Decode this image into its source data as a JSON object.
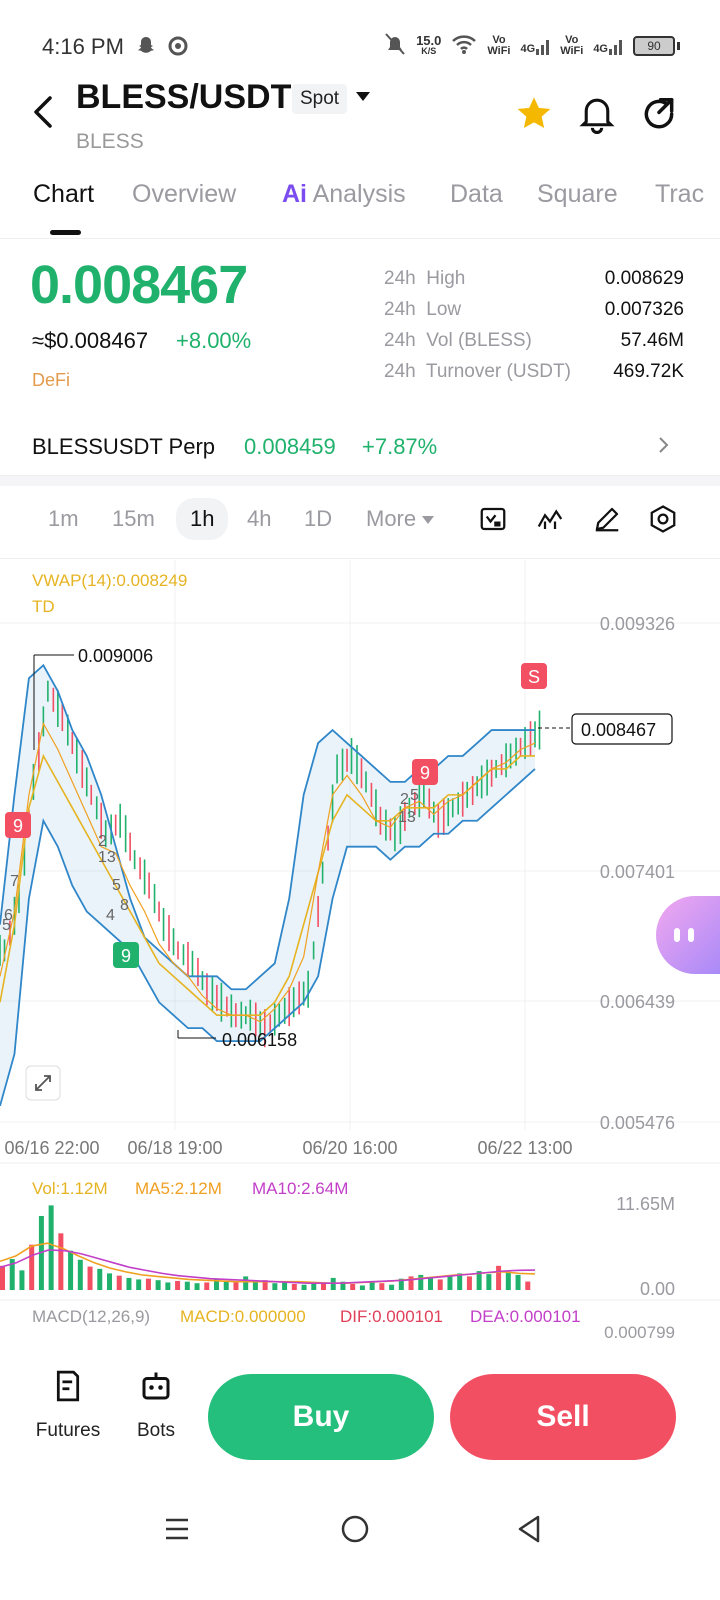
{
  "status_bar": {
    "time": "4:16 PM",
    "speed_value": "15.0",
    "speed_unit": "K/S",
    "vowifi_1": "Vo\nWiFi",
    "net_1": "4G",
    "vowifi_2": "Vo\nWiFi",
    "net_2": "4G",
    "battery": "90"
  },
  "header": {
    "pair": "BLESS/USDT",
    "market_type": "Spot",
    "base_asset": "BLESS"
  },
  "tabs": [
    {
      "label": "Chart",
      "active": true
    },
    {
      "label": "Overview",
      "active": false
    },
    {
      "label": "Analysis",
      "ai_prefix": "Ai",
      "active": false
    },
    {
      "label": "Data",
      "active": false
    },
    {
      "label": "Square",
      "active": false
    },
    {
      "label": "Trac",
      "active": false
    }
  ],
  "price": {
    "last": "0.008467",
    "usd_equivalent": "≈$0.008467",
    "change_pct": "+8.00%",
    "sector": "DeFi"
  },
  "stats": [
    {
      "label": "24h  High",
      "value": "0.008629"
    },
    {
      "label": "24h  Low",
      "value": "0.007326"
    },
    {
      "label": "24h  Vol (BLESS)",
      "value": "57.46M"
    },
    {
      "label": "24h  Turnover (USDT)",
      "value": "469.72K"
    }
  ],
  "perp": {
    "name": "BLESSUSDT Perp",
    "price": "0.008459",
    "change": "+7.87%"
  },
  "intervals": {
    "items": [
      "1m",
      "15m",
      "1h",
      "4h",
      "1D"
    ],
    "active": "1h",
    "more_label": "More"
  },
  "chart_data": {
    "type": "line",
    "title": "",
    "indicator_vwap": "VWAP(14):0.008249",
    "indicator_td": "TD",
    "y_ticks": [
      "0.009326",
      "0.007401",
      "0.006439",
      "0.005476"
    ],
    "ylim": [
      0.005476,
      0.009326
    ],
    "x_ticks": [
      "06/16 22:00",
      "06/18 19:00",
      "06/20 16:00",
      "06/22 13:00"
    ],
    "current_price_label": "0.008467",
    "high_marker": "0.009006",
    "low_marker": "0.006158",
    "td_markers": [
      "9",
      "9",
      "9",
      "S"
    ],
    "td_count_labels": [
      "7",
      "6",
      "5",
      "2",
      "13",
      "5",
      "4",
      "8",
      "2",
      "5",
      "13"
    ],
    "price_series": [
      {
        "name": "close",
        "values": [
          0.0068,
          0.0072,
          0.0081,
          0.0088,
          0.0086,
          0.0083,
          0.008,
          0.0077,
          0.0078,
          0.0075,
          0.0073,
          0.007,
          0.0068,
          0.0067,
          0.0065,
          0.0064,
          0.0063,
          0.0063,
          0.0062,
          0.0063,
          0.0064,
          0.0065,
          0.0074,
          0.0082,
          0.0083,
          0.0081,
          0.0078,
          0.0077,
          0.0079,
          0.008,
          0.0078,
          0.0079,
          0.008,
          0.0081,
          0.0082,
          0.0083,
          0.0084,
          0.0085
        ]
      },
      {
        "name": "boll_upper",
        "values": [
          0.007,
          0.008,
          0.0089,
          0.009,
          0.0088,
          0.0085,
          0.0083,
          0.008,
          0.0076,
          0.0072,
          0.0069,
          0.0068,
          0.0067,
          0.0066,
          0.0066,
          0.0066,
          0.0065,
          0.0065,
          0.0066,
          0.0067,
          0.0072,
          0.008,
          0.0084,
          0.0085,
          0.0084,
          0.0083,
          0.0082,
          0.0081,
          0.0081,
          0.0082,
          0.0082,
          0.0083,
          0.0083,
          0.0084,
          0.0085,
          0.0085,
          0.0085,
          0.0085
        ]
      },
      {
        "name": "boll_lower",
        "values": [
          0.0056,
          0.006,
          0.0072,
          0.0078,
          0.0076,
          0.0073,
          0.0071,
          0.007,
          0.0069,
          0.0068,
          0.0066,
          0.0064,
          0.0063,
          0.0062,
          0.0062,
          0.0061,
          0.0061,
          0.0061,
          0.0061,
          0.0062,
          0.0063,
          0.0064,
          0.0066,
          0.0072,
          0.0076,
          0.0076,
          0.0076,
          0.0075,
          0.0076,
          0.0076,
          0.0077,
          0.0077,
          0.0078,
          0.0078,
          0.0079,
          0.008,
          0.0081,
          0.0082
        ]
      },
      {
        "name": "vwap",
        "values": [
          0.0064,
          0.007,
          0.0079,
          0.0083,
          0.0081,
          0.0079,
          0.0077,
          0.0075,
          0.0073,
          0.0071,
          0.0069,
          0.0067,
          0.0066,
          0.0065,
          0.0064,
          0.0063,
          0.0063,
          0.0063,
          0.0063,
          0.0064,
          0.0066,
          0.007,
          0.0074,
          0.0078,
          0.008,
          0.0079,
          0.0078,
          0.0078,
          0.0079,
          0.0079,
          0.0079,
          0.008,
          0.008,
          0.0081,
          0.0082,
          0.0082,
          0.0083,
          0.0083
        ]
      }
    ],
    "volume": {
      "vol_label": "Vol:1.12M",
      "ma5_label": "MA5:2.12M",
      "ma10_label": "MA10:2.64M",
      "y_ticks": [
        "11.65M",
        "0.00"
      ],
      "bars_m": [
        3.2,
        4.1,
        2.6,
        6.0,
        9.8,
        11.2,
        7.5,
        5.2,
        4.0,
        3.1,
        2.8,
        2.2,
        1.9,
        1.6,
        1.4,
        1.5,
        1.3,
        1.0,
        1.2,
        1.1,
        0.9,
        1.0,
        1.4,
        1.2,
        1.1,
        1.8,
        1.0,
        1.3,
        0.9,
        1.1,
        0.8,
        0.7,
        0.9,
        1.0,
        1.6,
        1.1,
        0.8,
        0.6,
        1.2,
        0.9,
        0.7,
        1.5,
        1.8,
        2.0,
        1.7,
        1.4,
        1.9,
        2.2,
        1.8,
        2.5,
        2.1,
        3.2,
        2.4,
        2.0,
        1.12
      ],
      "ma5_m": [
        3.8,
        4.5,
        5.8,
        6.2,
        5.5,
        4.5,
        3.6,
        2.9,
        2.4,
        2.0,
        1.8,
        1.6,
        1.4,
        1.3,
        1.2,
        1.1,
        1.1,
        1.1,
        1.1,
        1.1,
        1.0,
        0.9,
        0.9,
        1.0,
        1.1,
        1.2,
        1.4,
        1.6,
        1.8,
        2.0,
        2.1,
        2.3,
        2.4,
        2.2,
        2.12
      ],
      "ma10_m": [
        3.0,
        3.6,
        4.6,
        5.3,
        5.2,
        4.8,
        4.2,
        3.6,
        3.0,
        2.6,
        2.2,
        1.9,
        1.7,
        1.5,
        1.4,
        1.3,
        1.2,
        1.1,
        1.0,
        0.9,
        0.9,
        0.9,
        1.0,
        1.1,
        1.2,
        1.3,
        1.5,
        1.7,
        1.9,
        2.1,
        2.3,
        2.5,
        2.6,
        2.64
      ]
    },
    "macd": {
      "title": "MACD(12,26,9)",
      "macd_label": "MACD:0.000000",
      "dif_label": "DIF:0.000101",
      "dea_label": "DEA:0.000101",
      "y_tick": "0.000799"
    }
  },
  "bottom_bar": {
    "futures_label": "Futures",
    "bots_label": "Bots",
    "buy_label": "Buy",
    "sell_label": "Sell"
  },
  "colors": {
    "up": "#20b26c",
    "down": "#f24f63",
    "vwap": "#e6b422",
    "ma5": "#f0a020",
    "ma10": "#c23fc8",
    "boll": "#2f86c9",
    "accent_ai": "#7b4cf0"
  }
}
